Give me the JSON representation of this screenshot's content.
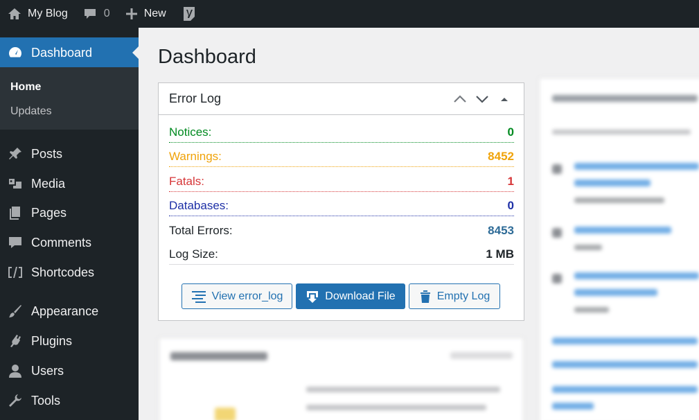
{
  "adminbar": {
    "site_name": "My Blog",
    "comments_count": "0",
    "new_label": "New"
  },
  "sidebar": {
    "active": {
      "label": "Dashboard",
      "icon": "dashboard-icon"
    },
    "submenu": [
      {
        "label": "Home",
        "current": true
      },
      {
        "label": "Updates",
        "current": false
      }
    ],
    "items": [
      {
        "label": "Posts",
        "icon": "pin-icon"
      },
      {
        "label": "Media",
        "icon": "media-icon"
      },
      {
        "label": "Pages",
        "icon": "pages-icon"
      },
      {
        "label": "Comments",
        "icon": "comment-icon"
      },
      {
        "label": "Shortcodes",
        "icon": "shortcode-icon"
      },
      {
        "label": "Appearance",
        "icon": "brush-icon"
      },
      {
        "label": "Plugins",
        "icon": "plugin-icon"
      },
      {
        "label": "Users",
        "icon": "user-icon"
      },
      {
        "label": "Tools",
        "icon": "wrench-icon"
      }
    ]
  },
  "main": {
    "page_title": "Dashboard",
    "widget": {
      "title": "Error Log",
      "rows": [
        {
          "label": "Notices:",
          "value": "0",
          "color": "#008a20"
        },
        {
          "label": "Warnings:",
          "value": "8452",
          "color": "#f0a30a"
        },
        {
          "label": "Fatals:",
          "value": "1",
          "color": "#d63638"
        },
        {
          "label": "Databases:",
          "value": "0",
          "color": "#1d2fa6"
        },
        {
          "label": "Total Errors:",
          "value": "8453",
          "color": "#2e6b97"
        },
        {
          "label": "Log Size:",
          "value": "1 MB",
          "color": "#1d2327"
        }
      ],
      "buttons": {
        "view": "View error_log",
        "download": "Download File",
        "empty": "Empty Log"
      }
    }
  },
  "colors": {
    "accent": "#2271b1",
    "adminbar_bg": "#1d2327",
    "submenu_bg": "#2c3338"
  }
}
